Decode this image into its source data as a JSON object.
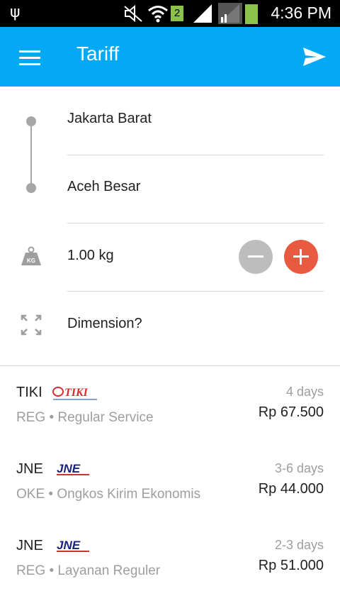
{
  "status_bar": {
    "time": "4:36 PM",
    "sim_slot": "2"
  },
  "toolbar": {
    "title": "Tariff"
  },
  "form": {
    "origin": "Jakarta Barat",
    "destination": "Aceh Besar",
    "weight": "1.00 kg",
    "weight_icon_label": "KG",
    "dimension": "Dimension?"
  },
  "tariffs": [
    {
      "courier": "TIKI",
      "logo": "tiki-logo",
      "code": "REG",
      "service": "Regular Service",
      "days": "4 days",
      "price": "Rp 67.500"
    },
    {
      "courier": "JNE",
      "logo": "jne-logo",
      "code": "OKE",
      "service": "Ongkos Kirim Ekonomis",
      "days": "3-6 days",
      "price": "Rp 44.000"
    },
    {
      "courier": "JNE",
      "logo": "jne-logo",
      "code": "REG",
      "service": "Layanan Reguler",
      "days": "2-3 days",
      "price": "Rp 51.000"
    }
  ],
  "colors": {
    "primary": "#03a9f4",
    "accent": "#e85a3f",
    "disabled": "#bdbdbd"
  }
}
